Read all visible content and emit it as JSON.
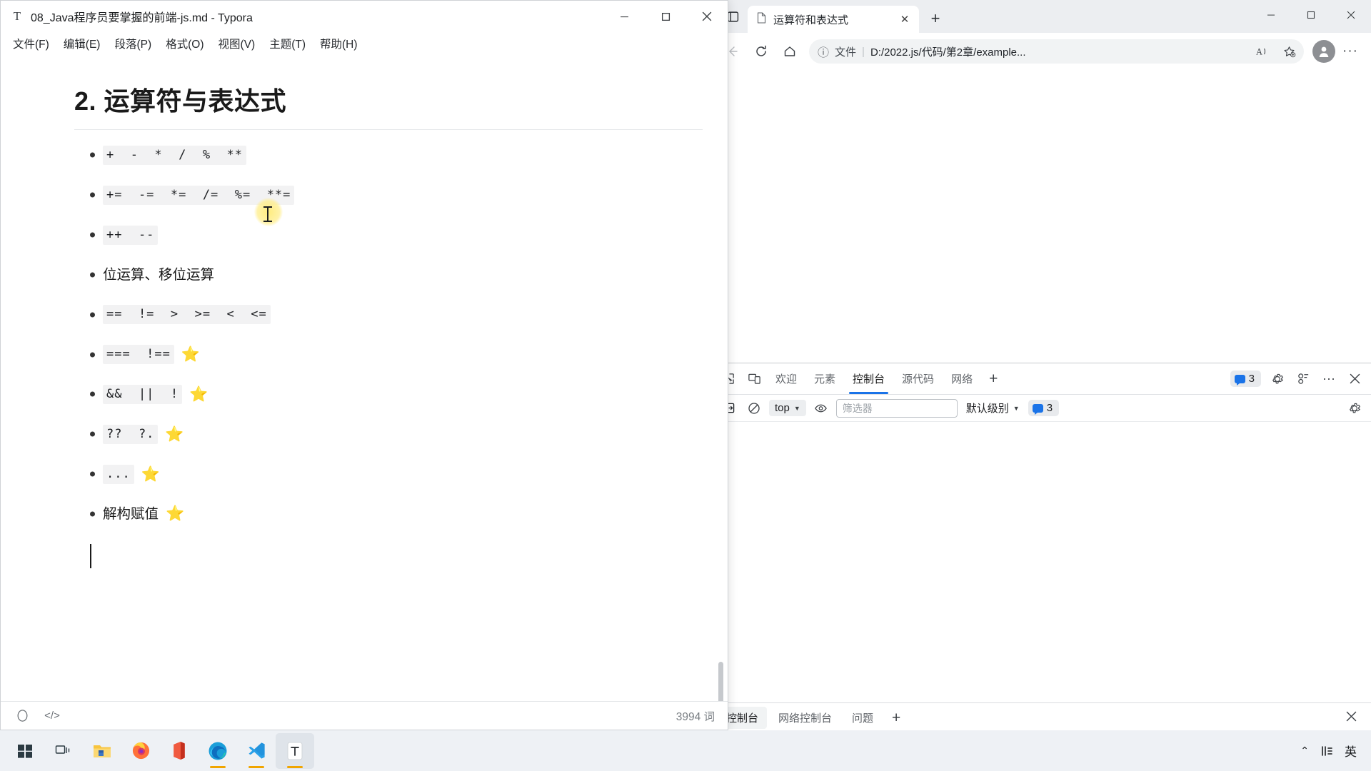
{
  "typora": {
    "title": "08_Java程序员要掌握的前端-js.md - Typora",
    "app_icon": "T",
    "window_controls": {
      "minimize": "–",
      "maximize": "□",
      "close": "✕"
    },
    "menu": [
      {
        "label": "文件(F)",
        "name": "menu-file"
      },
      {
        "label": "编辑(E)",
        "name": "menu-edit"
      },
      {
        "label": "段落(P)",
        "name": "menu-paragraph"
      },
      {
        "label": "格式(O)",
        "name": "menu-format"
      },
      {
        "label": "视图(V)",
        "name": "menu-view"
      },
      {
        "label": "主题(T)",
        "name": "menu-theme"
      },
      {
        "label": "帮助(H)",
        "name": "menu-help"
      }
    ],
    "document": {
      "heading": "2. 运算符与表达式",
      "items": [
        {
          "code": "+  -  *  /  %  **",
          "text": "",
          "star": ""
        },
        {
          "code": "+=  -=  *=  /=  %=  **=",
          "text": "",
          "star": ""
        },
        {
          "code": "++  --",
          "text": "",
          "star": ""
        },
        {
          "code": "",
          "text": "位运算、移位运算",
          "star": ""
        },
        {
          "code": "==  !=  >  >=  <  <=",
          "text": "",
          "star": ""
        },
        {
          "code": "===  !==",
          "text": "",
          "star": "⭐"
        },
        {
          "code": "&&  ||  !",
          "text": "",
          "star": "⭐"
        },
        {
          "code": "??  ?.",
          "text": "",
          "star": "⭐"
        },
        {
          "code": "...",
          "text": "",
          "star": "⭐"
        },
        {
          "code": "",
          "text": "解构赋值",
          "star": "⭐"
        }
      ]
    },
    "statusbar": {
      "source_toggle_icon": "</>",
      "outline_icon": "circle-icon",
      "word_count": "3994 词"
    }
  },
  "edge": {
    "tab": {
      "title": "运算符和表达式",
      "close_label": "✕",
      "favicon": "page-icon"
    },
    "new_tab_label": "+",
    "tab_search_icon": "tab-actions-icon",
    "window_controls": {
      "minimize": "–",
      "maximize": "□",
      "close": "✕"
    },
    "toolbar": {
      "back_label": "←",
      "refresh_label": "⟳",
      "home_label": "⌂",
      "read_aloud_label": "A",
      "favorite_label": "☆",
      "profile_label": "person-icon",
      "more_label": "···"
    },
    "omnibox": {
      "info_icon": "ⓘ",
      "scheme": "文件",
      "separator": "|",
      "url": "D:/2022.js/代码/第2章/example..."
    }
  },
  "devtools": {
    "tabs": [
      {
        "label": "欢迎",
        "active": false
      },
      {
        "label": "元素",
        "active": false
      },
      {
        "label": "控制台",
        "active": true
      },
      {
        "label": "源代码",
        "active": false
      },
      {
        "label": "网络",
        "active": false
      }
    ],
    "add_tab_label": "+",
    "issue_badge_count": "3",
    "inspect_icon": "inspect-element-icon",
    "device_toggle_icon": "device-emulation-icon",
    "settings_icon": "gear-icon",
    "customize_icon": "devtools-customize-icon",
    "more_icon": "···",
    "close_icon": "✕",
    "console": {
      "sidebar_toggle_icon": "console-sidebar-icon",
      "clear_icon": "clear-console-icon",
      "context": "top",
      "eye_icon": "live-expression-icon",
      "filter_placeholder": "筛选器",
      "filter_value": "",
      "level": "默认级别",
      "issues_count": "3",
      "settings_icon": "gear-icon",
      "prompt": "›"
    },
    "drawer": {
      "tabs": [
        {
          "label": "控制台",
          "active": true
        },
        {
          "label": "网络控制台",
          "active": false
        },
        {
          "label": "问题",
          "active": false
        }
      ],
      "add_label": "+",
      "close_label": "✕"
    }
  },
  "taskbar": {
    "items": [
      {
        "name": "start-button",
        "icon": "windows-logo-icon",
        "running": false,
        "active": false
      },
      {
        "name": "task-view-button",
        "icon": "task-view-icon",
        "running": false,
        "active": false
      },
      {
        "name": "file-explorer-button",
        "icon": "folder-icon",
        "running": false,
        "active": false
      },
      {
        "name": "firefox-button",
        "icon": "firefox-icon",
        "running": false,
        "active": false
      },
      {
        "name": "office-button",
        "icon": "office-icon",
        "running": false,
        "active": false
      },
      {
        "name": "edge-button",
        "icon": "edge-icon",
        "running": true,
        "active": false
      },
      {
        "name": "vscode-button",
        "icon": "vscode-icon",
        "running": true,
        "active": false
      },
      {
        "name": "typora-button",
        "icon": "typora-icon",
        "running": true,
        "active": true
      }
    ],
    "tray": {
      "overflow": "⌃",
      "ime_mode": "英",
      "ime_icon": "ime-icon"
    }
  },
  "colors": {
    "accent": "#1a73e8",
    "star": "#f5b731",
    "taskbar_indicator": "#f0a500",
    "code_bg": "#f2f2f3"
  }
}
